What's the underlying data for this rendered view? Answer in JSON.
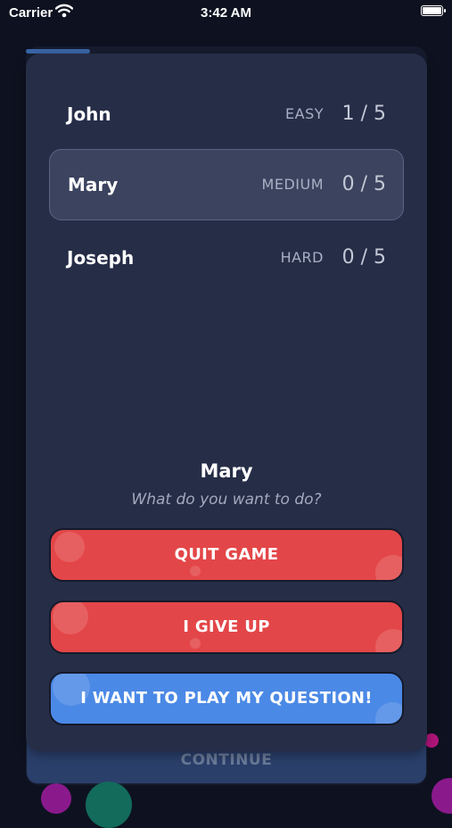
{
  "status_bar": {
    "carrier": "Carrier",
    "time": "3:42 AM"
  },
  "background": {
    "continue_label": "CONTINUE"
  },
  "players": [
    {
      "name": "John",
      "level": "EASY",
      "score": "1 / 5",
      "selected": false
    },
    {
      "name": "Mary",
      "level": "MEDIUM",
      "score": "0 / 5",
      "selected": true
    },
    {
      "name": "Joseph",
      "level": "HARD",
      "score": "0 / 5",
      "selected": false
    }
  ],
  "prompt": {
    "player": "Mary",
    "question": "What do you want to do?"
  },
  "actions": {
    "quit": "QUIT GAME",
    "give_up": "I GIVE UP",
    "play": "I WANT TO PLAY MY QUESTION!"
  },
  "colors": {
    "red_button": "#e34648",
    "blue_button": "#4b89e6",
    "modal": "#262d47",
    "selected_row": "#3b435e"
  }
}
